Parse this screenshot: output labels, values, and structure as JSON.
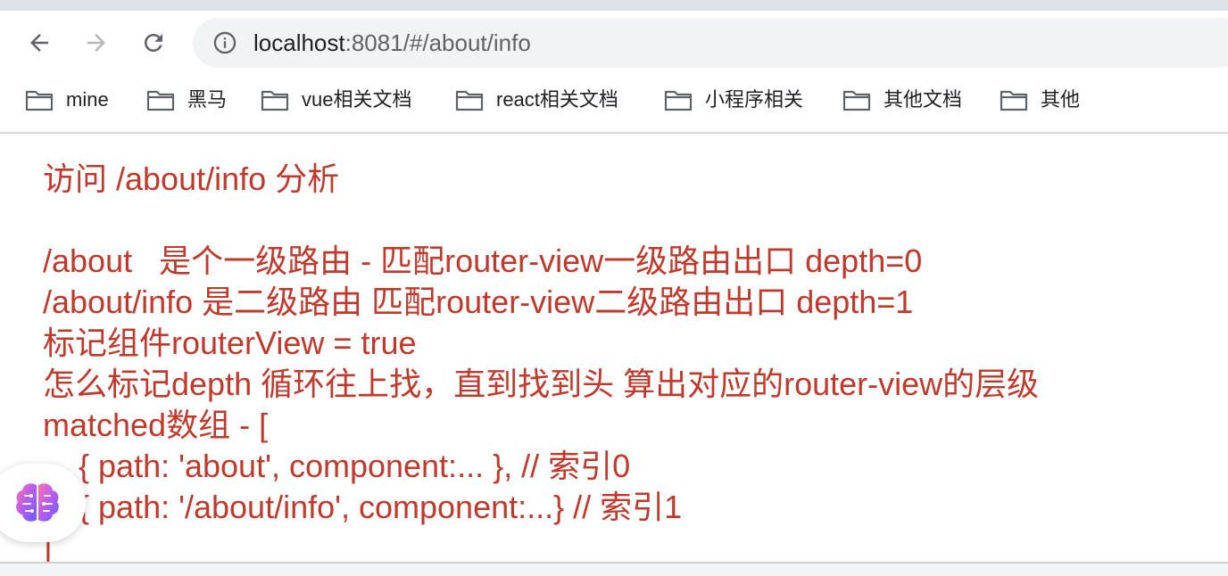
{
  "browser": {
    "url_host": "localhost",
    "url_rest": ":8081/#/about/info",
    "icons": {
      "back": "arrow-left-icon",
      "forward": "arrow-right-icon",
      "reload": "reload-icon",
      "site_info": "info-icon"
    }
  },
  "bookmarks": [
    {
      "label": "mine"
    },
    {
      "label": "黑马"
    },
    {
      "label": "vue相关文档"
    },
    {
      "label": "react相关文档"
    },
    {
      "label": "小程序相关"
    },
    {
      "label": "其他文档"
    },
    {
      "label": "其他"
    }
  ],
  "content": {
    "color": "#c0392b",
    "lines": [
      "访问 /about/info 分析",
      "",
      "/about   是个一级路由 - 匹配router-view一级路由出口 depth=0",
      "/about/info 是二级路由 匹配router-view二级路由出口 depth=1",
      "标记组件routerView = true",
      "怎么标记depth 循环往上找，直到找到头 算出对应的router-view的层级",
      "matched数组 - [",
      "    { path: 'about', component:... }, // 索引0",
      "    { path: '/about/info', component:...} // 索引1",
      "]"
    ]
  },
  "floating_button": {
    "icon": "brain-icon"
  }
}
